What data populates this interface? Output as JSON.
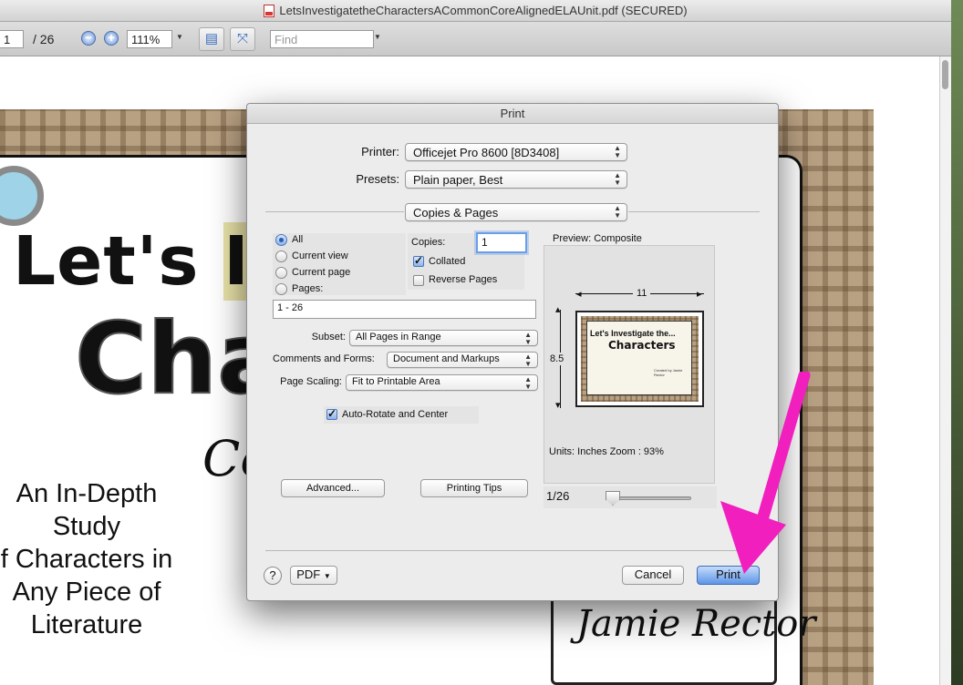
{
  "window": {
    "title": "LetsInvestigatetheCharactersACommonCoreAlignedELAUnit.pdf (SECURED)"
  },
  "toolbar": {
    "page_current": "1",
    "page_total": "/ 26",
    "zoom": "111%",
    "find_placeholder": "Find",
    "icons": [
      "zoom-out-icon",
      "zoom-in-icon",
      "single-page-icon",
      "fit-page-icon"
    ]
  },
  "document": {
    "title_line1_a": "Let's ",
    "title_line1_b": "In",
    "title_line2": "Cha",
    "cursive": "Co",
    "subtitle": [
      "An In-Depth",
      "Study",
      "f Characters in",
      "Any Piece of",
      "Literature"
    ],
    "author": "Jamie Rector"
  },
  "print_dialog": {
    "title": "Print",
    "printer_label": "Printer:",
    "printer_value": "Officejet Pro 8600 [8D3408]",
    "presets_label": "Presets:",
    "presets_value": "Plain paper, Best",
    "section_value": "Copies & Pages",
    "pages": {
      "all": "All",
      "current_view": "Current view",
      "current_page": "Current page",
      "pages": "Pages:",
      "range": "1 - 26",
      "selected": "all"
    },
    "copies_label": "Copies:",
    "copies_value": "1",
    "collated_label": "Collated",
    "collated_checked": true,
    "reverse_label": "Reverse Pages",
    "reverse_checked": false,
    "subset_label": "Subset:",
    "subset_value": "All Pages in Range",
    "comments_label": "Comments and Forms:",
    "comments_value": "Document and Markups",
    "scaling_label": "Page Scaling:",
    "scaling_value": "Fit to Printable Area",
    "autorotate_label": "Auto-Rotate and Center",
    "autorotate_checked": true,
    "advanced_button": "Advanced...",
    "tips_button": "Printing Tips",
    "preview": {
      "label": "Preview: Composite",
      "width_dim": "11",
      "height_dim": "8.5",
      "units_zoom": "Units: Inches Zoom :  93%",
      "page_indicator": "1/26",
      "thumb_title1": "Let's Investigate the...",
      "thumb_title2": "Characters",
      "thumb_by": "Created by Jamie Rector"
    },
    "help_button": "?",
    "pdf_button": "PDF",
    "cancel_button": "Cancel",
    "print_button": "Print"
  },
  "colors": {
    "accent_arrow": "#f01fbe",
    "default_button": "#5d95e6",
    "plaid": "#b8a082"
  }
}
